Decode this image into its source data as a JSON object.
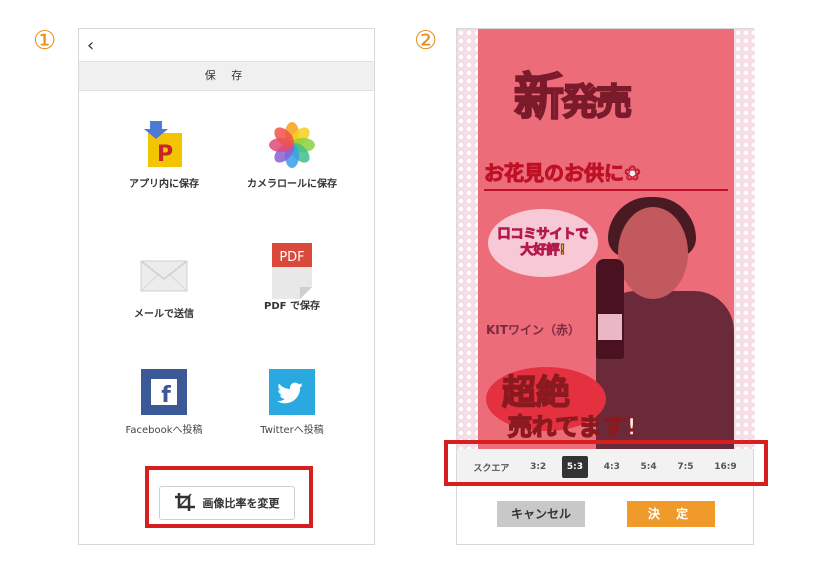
{
  "steps": {
    "step1": "①",
    "step2": "②"
  },
  "screen1": {
    "back_icon": "‹",
    "title": "保 存",
    "options": [
      {
        "label": "アプリ内に保存",
        "icon": "app-save-icon"
      },
      {
        "label": "カメラロールに保存",
        "icon": "photos-icon"
      },
      {
        "label": "メールで送信",
        "icon": "mail-icon"
      },
      {
        "label": "PDF で保存",
        "icon": "pdf-icon"
      },
      {
        "label": "Facebookへ投稿",
        "icon": "facebook-icon"
      },
      {
        "label": "Twitterへ投稿",
        "icon": "twitter-icon"
      }
    ],
    "pdf_text": "PDF",
    "app_icon_letter": "P",
    "facebook_letter": "f",
    "aspect_button": "画像比率を変更"
  },
  "screen2": {
    "poster": {
      "title_big": "新",
      "title_rest": "発売",
      "subtitle": "お花見のお供に❀",
      "burst_line1": "口コミサイトで",
      "burst_line2": "大好評!",
      "product": "KITワイン（赤）",
      "super": "超絶",
      "selling": "売れてます!"
    },
    "ratios": [
      "スクエア",
      "3:2",
      "5:3",
      "4:3",
      "5:4",
      "7:5",
      "16:9"
    ],
    "selected_ratio": "5:3",
    "cancel_label": "キャンセル",
    "ok_label": "決 定"
  },
  "colors": {
    "highlight": "#d62020",
    "step_number": "#e8901a",
    "ok_button": "#f09a2c",
    "cancel_button": "#c8c8c8",
    "poster_bg": "#ec6c7a"
  }
}
